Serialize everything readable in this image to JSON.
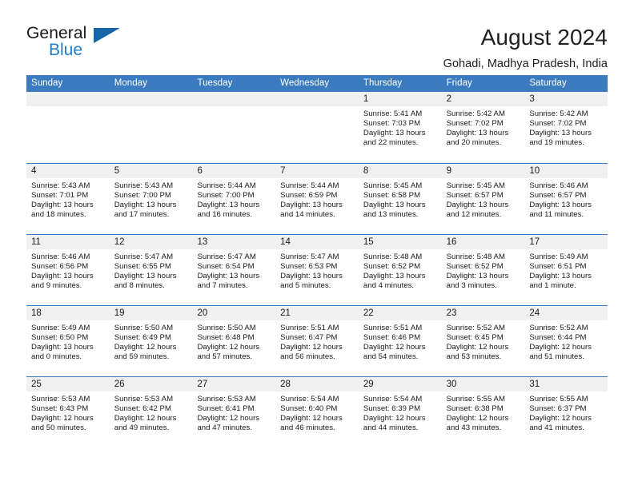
{
  "brand": {
    "name_part1": "General",
    "name_part2": "Blue",
    "triangle_icon": "triangle-icon",
    "accent_color": "#1565a8",
    "blue_text_color": "#1f7fc4"
  },
  "header": {
    "title": "August 2024",
    "location": "Gohadi, Madhya Pradesh, India"
  },
  "calendar": {
    "header_bg": "#3a7cbf",
    "daynum_bg": "#f0f0f0",
    "weekdays": [
      "Sunday",
      "Monday",
      "Tuesday",
      "Wednesday",
      "Thursday",
      "Friday",
      "Saturday"
    ],
    "weeks": [
      [
        {
          "day": "",
          "sunrise": "",
          "sunset": "",
          "daylight_line1": "",
          "daylight_line2": ""
        },
        {
          "day": "",
          "sunrise": "",
          "sunset": "",
          "daylight_line1": "",
          "daylight_line2": ""
        },
        {
          "day": "",
          "sunrise": "",
          "sunset": "",
          "daylight_line1": "",
          "daylight_line2": ""
        },
        {
          "day": "",
          "sunrise": "",
          "sunset": "",
          "daylight_line1": "",
          "daylight_line2": ""
        },
        {
          "day": "1",
          "sunrise": "Sunrise: 5:41 AM",
          "sunset": "Sunset: 7:03 PM",
          "daylight_line1": "Daylight: 13 hours",
          "daylight_line2": "and 22 minutes."
        },
        {
          "day": "2",
          "sunrise": "Sunrise: 5:42 AM",
          "sunset": "Sunset: 7:02 PM",
          "daylight_line1": "Daylight: 13 hours",
          "daylight_line2": "and 20 minutes."
        },
        {
          "day": "3",
          "sunrise": "Sunrise: 5:42 AM",
          "sunset": "Sunset: 7:02 PM",
          "daylight_line1": "Daylight: 13 hours",
          "daylight_line2": "and 19 minutes."
        }
      ],
      [
        {
          "day": "4",
          "sunrise": "Sunrise: 5:43 AM",
          "sunset": "Sunset: 7:01 PM",
          "daylight_line1": "Daylight: 13 hours",
          "daylight_line2": "and 18 minutes."
        },
        {
          "day": "5",
          "sunrise": "Sunrise: 5:43 AM",
          "sunset": "Sunset: 7:00 PM",
          "daylight_line1": "Daylight: 13 hours",
          "daylight_line2": "and 17 minutes."
        },
        {
          "day": "6",
          "sunrise": "Sunrise: 5:44 AM",
          "sunset": "Sunset: 7:00 PM",
          "daylight_line1": "Daylight: 13 hours",
          "daylight_line2": "and 16 minutes."
        },
        {
          "day": "7",
          "sunrise": "Sunrise: 5:44 AM",
          "sunset": "Sunset: 6:59 PM",
          "daylight_line1": "Daylight: 13 hours",
          "daylight_line2": "and 14 minutes."
        },
        {
          "day": "8",
          "sunrise": "Sunrise: 5:45 AM",
          "sunset": "Sunset: 6:58 PM",
          "daylight_line1": "Daylight: 13 hours",
          "daylight_line2": "and 13 minutes."
        },
        {
          "day": "9",
          "sunrise": "Sunrise: 5:45 AM",
          "sunset": "Sunset: 6:57 PM",
          "daylight_line1": "Daylight: 13 hours",
          "daylight_line2": "and 12 minutes."
        },
        {
          "day": "10",
          "sunrise": "Sunrise: 5:46 AM",
          "sunset": "Sunset: 6:57 PM",
          "daylight_line1": "Daylight: 13 hours",
          "daylight_line2": "and 11 minutes."
        }
      ],
      [
        {
          "day": "11",
          "sunrise": "Sunrise: 5:46 AM",
          "sunset": "Sunset: 6:56 PM",
          "daylight_line1": "Daylight: 13 hours",
          "daylight_line2": "and 9 minutes."
        },
        {
          "day": "12",
          "sunrise": "Sunrise: 5:47 AM",
          "sunset": "Sunset: 6:55 PM",
          "daylight_line1": "Daylight: 13 hours",
          "daylight_line2": "and 8 minutes."
        },
        {
          "day": "13",
          "sunrise": "Sunrise: 5:47 AM",
          "sunset": "Sunset: 6:54 PM",
          "daylight_line1": "Daylight: 13 hours",
          "daylight_line2": "and 7 minutes."
        },
        {
          "day": "14",
          "sunrise": "Sunrise: 5:47 AM",
          "sunset": "Sunset: 6:53 PM",
          "daylight_line1": "Daylight: 13 hours",
          "daylight_line2": "and 5 minutes."
        },
        {
          "day": "15",
          "sunrise": "Sunrise: 5:48 AM",
          "sunset": "Sunset: 6:52 PM",
          "daylight_line1": "Daylight: 13 hours",
          "daylight_line2": "and 4 minutes."
        },
        {
          "day": "16",
          "sunrise": "Sunrise: 5:48 AM",
          "sunset": "Sunset: 6:52 PM",
          "daylight_line1": "Daylight: 13 hours",
          "daylight_line2": "and 3 minutes."
        },
        {
          "day": "17",
          "sunrise": "Sunrise: 5:49 AM",
          "sunset": "Sunset: 6:51 PM",
          "daylight_line1": "Daylight: 13 hours",
          "daylight_line2": "and 1 minute."
        }
      ],
      [
        {
          "day": "18",
          "sunrise": "Sunrise: 5:49 AM",
          "sunset": "Sunset: 6:50 PM",
          "daylight_line1": "Daylight: 13 hours",
          "daylight_line2": "and 0 minutes."
        },
        {
          "day": "19",
          "sunrise": "Sunrise: 5:50 AM",
          "sunset": "Sunset: 6:49 PM",
          "daylight_line1": "Daylight: 12 hours",
          "daylight_line2": "and 59 minutes."
        },
        {
          "day": "20",
          "sunrise": "Sunrise: 5:50 AM",
          "sunset": "Sunset: 6:48 PM",
          "daylight_line1": "Daylight: 12 hours",
          "daylight_line2": "and 57 minutes."
        },
        {
          "day": "21",
          "sunrise": "Sunrise: 5:51 AM",
          "sunset": "Sunset: 6:47 PM",
          "daylight_line1": "Daylight: 12 hours",
          "daylight_line2": "and 56 minutes."
        },
        {
          "day": "22",
          "sunrise": "Sunrise: 5:51 AM",
          "sunset": "Sunset: 6:46 PM",
          "daylight_line1": "Daylight: 12 hours",
          "daylight_line2": "and 54 minutes."
        },
        {
          "day": "23",
          "sunrise": "Sunrise: 5:52 AM",
          "sunset": "Sunset: 6:45 PM",
          "daylight_line1": "Daylight: 12 hours",
          "daylight_line2": "and 53 minutes."
        },
        {
          "day": "24",
          "sunrise": "Sunrise: 5:52 AM",
          "sunset": "Sunset: 6:44 PM",
          "daylight_line1": "Daylight: 12 hours",
          "daylight_line2": "and 51 minutes."
        }
      ],
      [
        {
          "day": "25",
          "sunrise": "Sunrise: 5:53 AM",
          "sunset": "Sunset: 6:43 PM",
          "daylight_line1": "Daylight: 12 hours",
          "daylight_line2": "and 50 minutes."
        },
        {
          "day": "26",
          "sunrise": "Sunrise: 5:53 AM",
          "sunset": "Sunset: 6:42 PM",
          "daylight_line1": "Daylight: 12 hours",
          "daylight_line2": "and 49 minutes."
        },
        {
          "day": "27",
          "sunrise": "Sunrise: 5:53 AM",
          "sunset": "Sunset: 6:41 PM",
          "daylight_line1": "Daylight: 12 hours",
          "daylight_line2": "and 47 minutes."
        },
        {
          "day": "28",
          "sunrise": "Sunrise: 5:54 AM",
          "sunset": "Sunset: 6:40 PM",
          "daylight_line1": "Daylight: 12 hours",
          "daylight_line2": "and 46 minutes."
        },
        {
          "day": "29",
          "sunrise": "Sunrise: 5:54 AM",
          "sunset": "Sunset: 6:39 PM",
          "daylight_line1": "Daylight: 12 hours",
          "daylight_line2": "and 44 minutes."
        },
        {
          "day": "30",
          "sunrise": "Sunrise: 5:55 AM",
          "sunset": "Sunset: 6:38 PM",
          "daylight_line1": "Daylight: 12 hours",
          "daylight_line2": "and 43 minutes."
        },
        {
          "day": "31",
          "sunrise": "Sunrise: 5:55 AM",
          "sunset": "Sunset: 6:37 PM",
          "daylight_line1": "Daylight: 12 hours",
          "daylight_line2": "and 41 minutes."
        }
      ]
    ]
  }
}
